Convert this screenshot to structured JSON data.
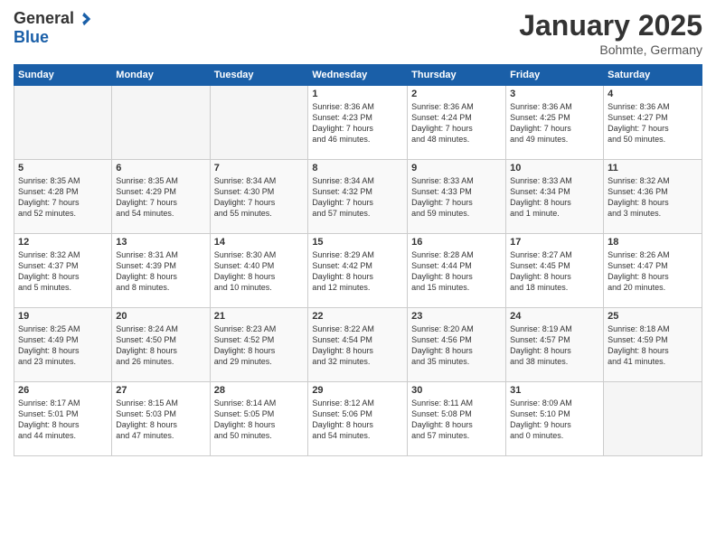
{
  "header": {
    "logo": {
      "general": "General",
      "blue": "Blue"
    },
    "title": "January 2025",
    "subtitle": "Bohmte, Germany"
  },
  "weekdays": [
    "Sunday",
    "Monday",
    "Tuesday",
    "Wednesday",
    "Thursday",
    "Friday",
    "Saturday"
  ],
  "weeks": [
    [
      {
        "day": "",
        "info": ""
      },
      {
        "day": "",
        "info": ""
      },
      {
        "day": "",
        "info": ""
      },
      {
        "day": "1",
        "info": "Sunrise: 8:36 AM\nSunset: 4:23 PM\nDaylight: 7 hours\nand 46 minutes."
      },
      {
        "day": "2",
        "info": "Sunrise: 8:36 AM\nSunset: 4:24 PM\nDaylight: 7 hours\nand 48 minutes."
      },
      {
        "day": "3",
        "info": "Sunrise: 8:36 AM\nSunset: 4:25 PM\nDaylight: 7 hours\nand 49 minutes."
      },
      {
        "day": "4",
        "info": "Sunrise: 8:36 AM\nSunset: 4:27 PM\nDaylight: 7 hours\nand 50 minutes."
      }
    ],
    [
      {
        "day": "5",
        "info": "Sunrise: 8:35 AM\nSunset: 4:28 PM\nDaylight: 7 hours\nand 52 minutes."
      },
      {
        "day": "6",
        "info": "Sunrise: 8:35 AM\nSunset: 4:29 PM\nDaylight: 7 hours\nand 54 minutes."
      },
      {
        "day": "7",
        "info": "Sunrise: 8:34 AM\nSunset: 4:30 PM\nDaylight: 7 hours\nand 55 minutes."
      },
      {
        "day": "8",
        "info": "Sunrise: 8:34 AM\nSunset: 4:32 PM\nDaylight: 7 hours\nand 57 minutes."
      },
      {
        "day": "9",
        "info": "Sunrise: 8:33 AM\nSunset: 4:33 PM\nDaylight: 7 hours\nand 59 minutes."
      },
      {
        "day": "10",
        "info": "Sunrise: 8:33 AM\nSunset: 4:34 PM\nDaylight: 8 hours\nand 1 minute."
      },
      {
        "day": "11",
        "info": "Sunrise: 8:32 AM\nSunset: 4:36 PM\nDaylight: 8 hours\nand 3 minutes."
      }
    ],
    [
      {
        "day": "12",
        "info": "Sunrise: 8:32 AM\nSunset: 4:37 PM\nDaylight: 8 hours\nand 5 minutes."
      },
      {
        "day": "13",
        "info": "Sunrise: 8:31 AM\nSunset: 4:39 PM\nDaylight: 8 hours\nand 8 minutes."
      },
      {
        "day": "14",
        "info": "Sunrise: 8:30 AM\nSunset: 4:40 PM\nDaylight: 8 hours\nand 10 minutes."
      },
      {
        "day": "15",
        "info": "Sunrise: 8:29 AM\nSunset: 4:42 PM\nDaylight: 8 hours\nand 12 minutes."
      },
      {
        "day": "16",
        "info": "Sunrise: 8:28 AM\nSunset: 4:44 PM\nDaylight: 8 hours\nand 15 minutes."
      },
      {
        "day": "17",
        "info": "Sunrise: 8:27 AM\nSunset: 4:45 PM\nDaylight: 8 hours\nand 18 minutes."
      },
      {
        "day": "18",
        "info": "Sunrise: 8:26 AM\nSunset: 4:47 PM\nDaylight: 8 hours\nand 20 minutes."
      }
    ],
    [
      {
        "day": "19",
        "info": "Sunrise: 8:25 AM\nSunset: 4:49 PM\nDaylight: 8 hours\nand 23 minutes."
      },
      {
        "day": "20",
        "info": "Sunrise: 8:24 AM\nSunset: 4:50 PM\nDaylight: 8 hours\nand 26 minutes."
      },
      {
        "day": "21",
        "info": "Sunrise: 8:23 AM\nSunset: 4:52 PM\nDaylight: 8 hours\nand 29 minutes."
      },
      {
        "day": "22",
        "info": "Sunrise: 8:22 AM\nSunset: 4:54 PM\nDaylight: 8 hours\nand 32 minutes."
      },
      {
        "day": "23",
        "info": "Sunrise: 8:20 AM\nSunset: 4:56 PM\nDaylight: 8 hours\nand 35 minutes."
      },
      {
        "day": "24",
        "info": "Sunrise: 8:19 AM\nSunset: 4:57 PM\nDaylight: 8 hours\nand 38 minutes."
      },
      {
        "day": "25",
        "info": "Sunrise: 8:18 AM\nSunset: 4:59 PM\nDaylight: 8 hours\nand 41 minutes."
      }
    ],
    [
      {
        "day": "26",
        "info": "Sunrise: 8:17 AM\nSunset: 5:01 PM\nDaylight: 8 hours\nand 44 minutes."
      },
      {
        "day": "27",
        "info": "Sunrise: 8:15 AM\nSunset: 5:03 PM\nDaylight: 8 hours\nand 47 minutes."
      },
      {
        "day": "28",
        "info": "Sunrise: 8:14 AM\nSunset: 5:05 PM\nDaylight: 8 hours\nand 50 minutes."
      },
      {
        "day": "29",
        "info": "Sunrise: 8:12 AM\nSunset: 5:06 PM\nDaylight: 8 hours\nand 54 minutes."
      },
      {
        "day": "30",
        "info": "Sunrise: 8:11 AM\nSunset: 5:08 PM\nDaylight: 8 hours\nand 57 minutes."
      },
      {
        "day": "31",
        "info": "Sunrise: 8:09 AM\nSunset: 5:10 PM\nDaylight: 9 hours\nand 0 minutes."
      },
      {
        "day": "",
        "info": ""
      }
    ]
  ]
}
